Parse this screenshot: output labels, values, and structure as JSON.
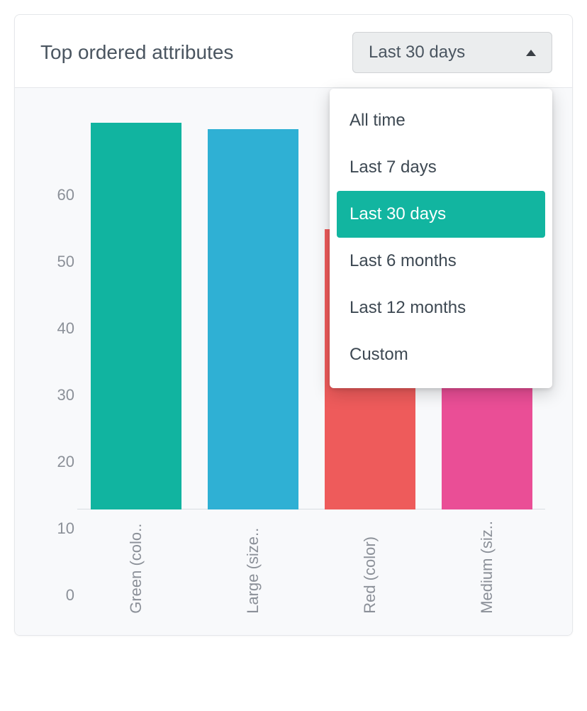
{
  "header": {
    "title": "Top ordered attributes"
  },
  "dropdown": {
    "selected_label": "Last 30 days",
    "options": [
      {
        "label": "All time",
        "selected": false
      },
      {
        "label": "Last 7 days",
        "selected": false
      },
      {
        "label": "Last 30 days",
        "selected": true
      },
      {
        "label": "Last 6 months",
        "selected": false
      },
      {
        "label": "Last 12 months",
        "selected": false
      },
      {
        "label": "Custom",
        "selected": false
      }
    ]
  },
  "chart_data": {
    "type": "bar",
    "categories": [
      "Green (colo..",
      "Large (size..",
      "Red (color)",
      "Medium (siz.."
    ],
    "values": [
      58,
      57,
      42,
      23
    ],
    "colors": [
      "#11b4a0",
      "#2fb0d4",
      "#ee5b5b",
      "#ea4e96"
    ],
    "y_ticks": [
      0,
      10,
      20,
      30,
      40,
      50,
      60
    ],
    "ylim": [
      0,
      60
    ],
    "title": "Top ordered attributes",
    "xlabel": "",
    "ylabel": ""
  }
}
